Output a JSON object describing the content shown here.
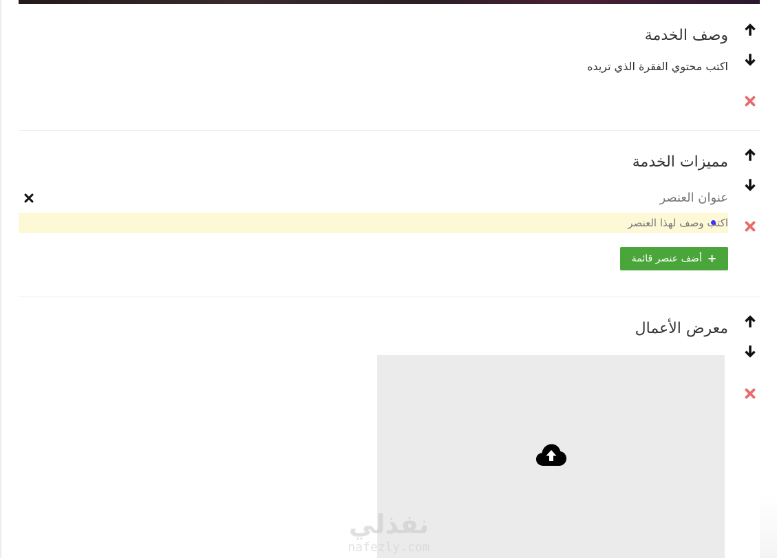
{
  "sections": {
    "description": {
      "title": "وصف الخدمة",
      "body": "اكتب محتوي الفقرة الذي تريده"
    },
    "features": {
      "title": "مميزات الخدمة",
      "item_title": "عنوان العنصر",
      "item_description": "اكتب وصف لهذا العنصر",
      "add_button_label": "أضف عنصر قائمة",
      "add_button_icon": "+"
    },
    "portfolio": {
      "title": "معرض الأعمال",
      "upload_icon": "cloud-upload-icon"
    }
  },
  "controls": {
    "move_up_icon": "arrow-up-icon",
    "move_down_icon": "arrow-down-icon",
    "delete_icon": "close-icon"
  },
  "watermark": {
    "arabic": "نفذلي",
    "latin": "nafezly.com"
  },
  "colors": {
    "accent_green": "#4aa63a",
    "delete_red": "#e86b6b",
    "highlight_yellow": "#fdf9d6",
    "upload_gray": "#ebebeb"
  }
}
